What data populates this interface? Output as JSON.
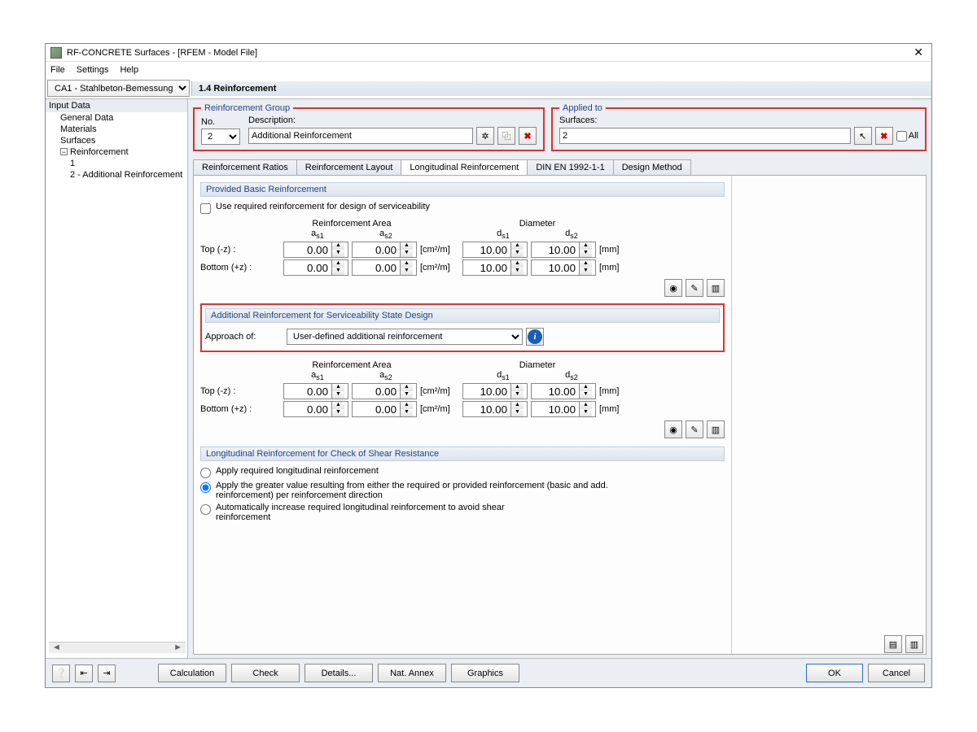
{
  "window": {
    "title": "RF-CONCRETE Surfaces - [RFEM - Model File]"
  },
  "menu": {
    "file": "File",
    "settings": "Settings",
    "help": "Help"
  },
  "case_select": "CA1 - Stahlbeton-Bemessung",
  "panel_title": "1.4 Reinforcement",
  "nav": {
    "header": "Input Data",
    "items": [
      "General Data",
      "Materials",
      "Surfaces",
      "Reinforcement"
    ],
    "reinf_children": [
      "1",
      "2 - Additional Reinforcement"
    ]
  },
  "reinf_group": {
    "title": "Reinforcement Group",
    "no_label": "No.",
    "no_value": "2",
    "desc_label": "Description:",
    "desc_value": "Additional Reinforcement"
  },
  "applied_to": {
    "title": "Applied to",
    "surf_label": "Surfaces:",
    "surf_value": "2",
    "all_label": "All"
  },
  "tabs": [
    "Reinforcement Ratios",
    "Reinforcement Layout",
    "Longitudinal Reinforcement",
    "DIN EN 1992-1-1",
    "Design Method"
  ],
  "active_tab": 2,
  "basic": {
    "title": "Provided Basic Reinforcement",
    "chk_label": "Use required reinforcement for design of serviceability",
    "area_hdr": "Reinforcement Area",
    "dia_hdr": "Diameter",
    "as1": "a",
    "as1_sub": "s1",
    "as2": "a",
    "as2_sub": "s2",
    "ds1": "d",
    "ds1_sub": "s1",
    "ds2": "d",
    "ds2_sub": "s2",
    "top_label": "Top (-z) :",
    "bot_label": "Bottom (+z) :",
    "unit_area": "[cm²/m]",
    "unit_dia": "[mm]",
    "top": {
      "a1": "0.00",
      "a2": "0.00",
      "d1": "10.00",
      "d2": "10.00"
    },
    "bot": {
      "a1": "0.00",
      "a2": "0.00",
      "d1": "10.00",
      "d2": "10.00"
    }
  },
  "additional": {
    "title": "Additional Reinforcement for Serviceability State Design",
    "approach_label": "Approach of:",
    "approach_value": "User-defined additional reinforcement",
    "top": {
      "a1": "0.00",
      "a2": "0.00",
      "d1": "10.00",
      "d2": "10.00"
    },
    "bot": {
      "a1": "0.00",
      "a2": "0.00",
      "d1": "10.00",
      "d2": "10.00"
    }
  },
  "shear": {
    "title": "Longitudinal Reinforcement for Check of Shear Resistance",
    "opt1": "Apply required longitudinal reinforcement",
    "opt2": "Apply the greater value resulting from either the required or provided reinforcement (basic and add. reinforcement) per reinforcement direction",
    "opt3": "Automatically increase required longitudinal reinforcement to avoid shear reinforcement",
    "selected": 1
  },
  "buttons": {
    "calc": "Calculation",
    "check": "Check",
    "details": "Details...",
    "annex": "Nat. Annex",
    "graphics": "Graphics",
    "ok": "OK",
    "cancel": "Cancel"
  }
}
